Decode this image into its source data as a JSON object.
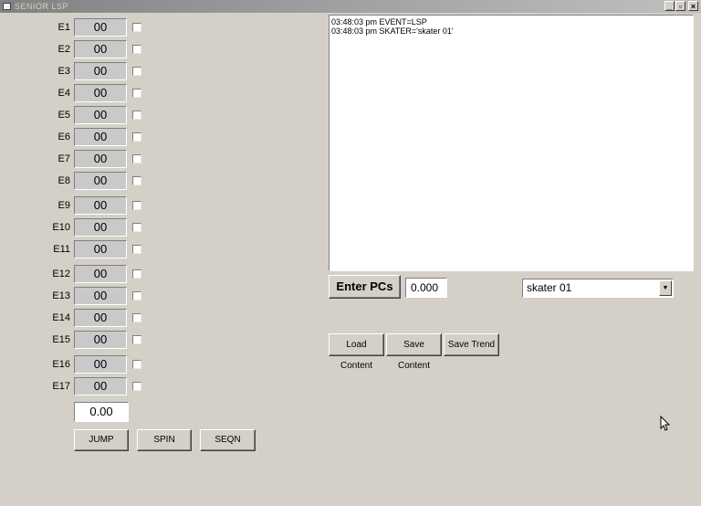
{
  "window": {
    "title": "SENIOR LSP",
    "controls": {
      "minimize": "_",
      "restore": "▫",
      "close": "×"
    }
  },
  "elements": [
    {
      "label": "E1",
      "score": "00"
    },
    {
      "label": "E2",
      "score": "00"
    },
    {
      "label": "E3",
      "score": "00"
    },
    {
      "label": "E4",
      "score": "00"
    },
    {
      "label": "E5",
      "score": "00"
    },
    {
      "label": "E6",
      "score": "00"
    },
    {
      "label": "E7",
      "score": "00"
    },
    {
      "label": "E8",
      "score": "00"
    },
    {
      "label": "E9",
      "score": "00"
    },
    {
      "label": "E10",
      "score": "00"
    },
    {
      "label": "E11",
      "score": "00"
    },
    {
      "label": "E12",
      "score": "00"
    },
    {
      "label": "E13",
      "score": "00"
    },
    {
      "label": "E14",
      "score": "00"
    },
    {
      "label": "E15",
      "score": "00"
    },
    {
      "label": "E16",
      "score": "00"
    },
    {
      "label": "E17",
      "score": "00"
    }
  ],
  "total": "0.00",
  "element_buttons": {
    "jump": "JUMP",
    "spin": "SPIN",
    "seqn": "SEQN"
  },
  "log": {
    "lines": [
      "03:48:03 pm  EVENT=LSP",
      "03:48:03 pm  SKATER='skater 01'"
    ]
  },
  "pcs": {
    "button": "Enter PCs",
    "value": "0.000"
  },
  "skater_select": {
    "value": "skater 01"
  },
  "content_buttons": {
    "load": "Load Content",
    "save": "Save Content",
    "trend": "Save Trend"
  }
}
